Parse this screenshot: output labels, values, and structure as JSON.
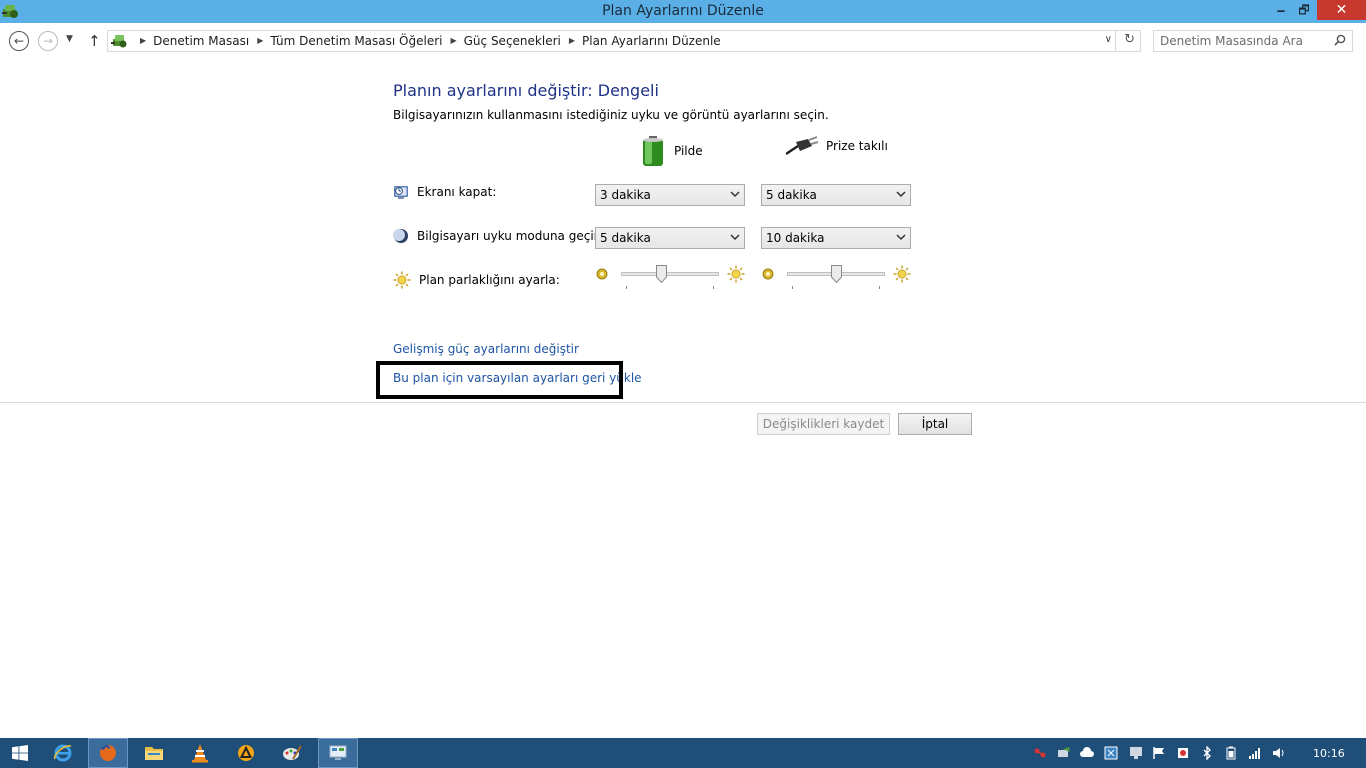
{
  "window": {
    "title": "Plan Ayarlarını Düzenle",
    "minimize_glyph": "🗕",
    "maximize_glyph": "🗗",
    "close_glyph": "✕"
  },
  "nav": {
    "back_glyph": "←",
    "forward_glyph": "→",
    "recent_glyph": "▼",
    "up_glyph": "↑",
    "breadcrumbs": [
      "Denetim Masası",
      "Tüm Denetim Masası Öğeleri",
      "Güç Seçenekleri",
      "Plan Ayarlarını Düzenle"
    ],
    "crumb_separator": "▶",
    "address_dropdown_glyph": "∨",
    "refresh_glyph": "↻",
    "search_placeholder": "Denetim Masasında Ara"
  },
  "content": {
    "heading": "Planın ayarlarını değiştir: Dengeli",
    "subtitle": "Bilgisayarınızın kullanmasını istediğiniz uyku ve görüntü ayarlarını seçin.",
    "columns": {
      "battery": "Pilde",
      "plugged": "Prize takılı"
    },
    "rows": {
      "display_label": "Ekranı kapat:",
      "sleep_label": "Bilgisayarı uyku moduna geçir:",
      "brightness_label": "Plan parlaklığını ayarla:"
    },
    "values": {
      "display_battery": "3 dakika",
      "display_plugged": "5 dakika",
      "sleep_battery": "5 dakika",
      "sleep_plugged": "10 dakika"
    },
    "brightness": {
      "battery_percent": 40,
      "plugged_percent": 50
    },
    "links": {
      "advanced": "Gelişmiş güç ayarlarını değiştir",
      "restore": "Bu plan için varsayılan ayarları geri yükle"
    },
    "buttons": {
      "save": "Değişiklikleri kaydet",
      "cancel": "İptal"
    }
  },
  "taskbar": {
    "clock": "10:16"
  },
  "colors": {
    "titlebar": "#5ab0e6",
    "heading": "#1e3287",
    "link": "#1e55a4",
    "taskbar": "#1f4e79",
    "close_button": "#c7392f"
  }
}
